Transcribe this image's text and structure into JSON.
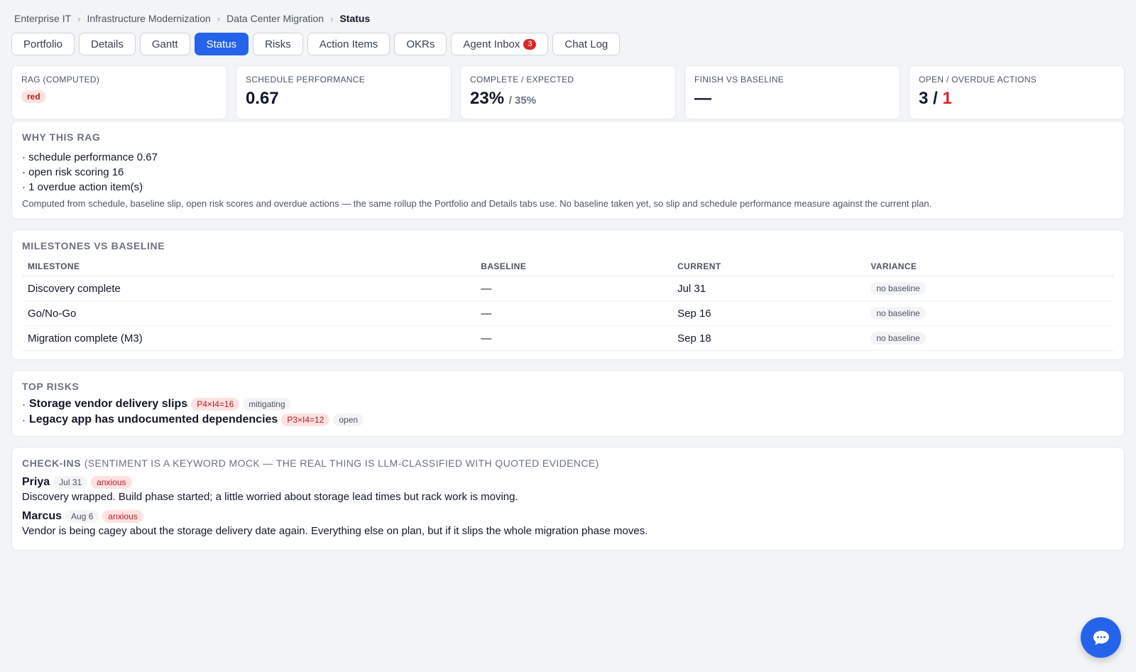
{
  "breadcrumb": [
    "Enterprise IT",
    "Infrastructure Modernization",
    "Data Center Migration",
    "Status"
  ],
  "tabs": [
    {
      "label": "Portfolio"
    },
    {
      "label": "Details"
    },
    {
      "label": "Gantt"
    },
    {
      "label": "Status",
      "active": true
    },
    {
      "label": "Risks"
    },
    {
      "label": "Action Items"
    },
    {
      "label": "OKRs"
    },
    {
      "label": "Agent Inbox",
      "badge": "3"
    },
    {
      "label": "Chat Log"
    }
  ],
  "kpis": {
    "rag": {
      "label": "RAG (COMPUTED)",
      "value": "red"
    },
    "schedule": {
      "label": "SCHEDULE PERFORMANCE",
      "value": "0.67"
    },
    "complete": {
      "label": "COMPLETE / EXPECTED",
      "value": "23%",
      "sub": "/ 35%"
    },
    "finish": {
      "label": "FINISH VS BASELINE",
      "value": "—"
    },
    "actions": {
      "label": "OPEN / OVERDUE ACTIONS",
      "open": "3 /",
      "overdue": "1"
    }
  },
  "why": {
    "title": "WHY THIS RAG",
    "items": [
      "· schedule performance 0.67",
      "· open risk scoring 16",
      "· 1 overdue action item(s)"
    ],
    "explanation": "Computed from schedule, baseline slip, open risk scores and overdue actions — the same rollup the Portfolio and Details tabs use. No baseline taken yet, so slip and schedule performance measure against the current plan."
  },
  "milestones": {
    "title": "MILESTONES VS BASELINE",
    "columns": [
      "MILESTONE",
      "BASELINE",
      "CURRENT",
      "VARIANCE"
    ],
    "rows": [
      {
        "name": "Discovery complete",
        "baseline": "—",
        "current": "Jul 31",
        "variance": "no baseline"
      },
      {
        "name": "Go/No-Go",
        "baseline": "—",
        "current": "Sep 16",
        "variance": "no baseline"
      },
      {
        "name": "Migration complete (M3)",
        "baseline": "—",
        "current": "Sep 18",
        "variance": "no baseline"
      }
    ]
  },
  "risks": {
    "title": "TOP RISKS",
    "items": [
      {
        "bullet": "·",
        "title": "Storage vendor delivery slips",
        "score": "P4×I4=16",
        "status": "mitigating"
      },
      {
        "bullet": "·",
        "title": "Legacy app has undocumented dependencies",
        "score": "P3×I4=12",
        "status": "open"
      }
    ]
  },
  "checkins": {
    "title": "CHECK-INS",
    "note": "(SENTIMENT IS A KEYWORD MOCK — THE REAL THING IS LLM-CLASSIFIED WITH QUOTED EVIDENCE)",
    "items": [
      {
        "name": "Priya",
        "date": "Jul 31",
        "sentiment": "anxious",
        "text": "Discovery wrapped. Build phase started; a little worried about storage lead times but rack work is moving."
      },
      {
        "name": "Marcus",
        "date": "Aug 6",
        "sentiment": "anxious",
        "text": "Vendor is being cagey about the storage delivery date again. Everything else on plan, but if it slips the whole migration phase moves."
      }
    ]
  },
  "chat_fab": {
    "icon": "chat-bubble-icon"
  },
  "colors": {
    "accent": "#2563eb",
    "danger": "#dc2626",
    "background": "#f3f4f6"
  }
}
